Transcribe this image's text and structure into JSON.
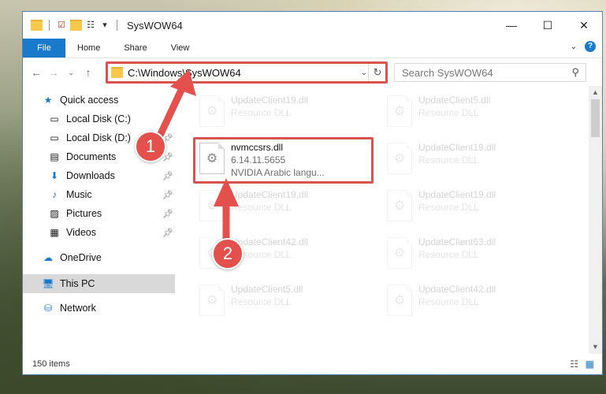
{
  "window": {
    "title": "SysWOW64"
  },
  "window_controls": {
    "minimize": "—",
    "maximize": "☐",
    "close": "✕"
  },
  "ribbon": {
    "file": "File",
    "home": "Home",
    "share": "Share",
    "view": "View",
    "expand": "⌄",
    "help": "?"
  },
  "address": {
    "path": "C:\\Windows\\SysWOW64"
  },
  "search": {
    "placeholder": "Search SysWOW64"
  },
  "sidebar": {
    "quick_access": "Quick access",
    "items": [
      {
        "label": "Local Disk (C:)"
      },
      {
        "label": "Local Disk (D:)"
      },
      {
        "label": "Documents"
      },
      {
        "label": "Downloads"
      },
      {
        "label": "Music"
      },
      {
        "label": "Pictures"
      },
      {
        "label": "Videos"
      }
    ],
    "onedrive": "OneDrive",
    "this_pc": "This PC",
    "network": "Network"
  },
  "files": {
    "selected": {
      "name": "nvmccsrs.dll",
      "version": "6.14.11.5655",
      "description": "NVIDIA Arabic langu..."
    },
    "faded": [
      {
        "name": "UpdateClient19.dll",
        "type": "Resource DLL"
      },
      {
        "name": "UpdateClient5.dll",
        "type": "Resource DLL"
      },
      {
        "name": "UpdateClient19.dll",
        "type": "Resource DLL"
      },
      {
        "name": "UpdateClient19.dll",
        "type": "Resource DLL"
      },
      {
        "name": "UpdateClient19.dll",
        "type": "Resource DLL"
      },
      {
        "name": "UpdateClient42.dll",
        "type": "Resource DLL"
      },
      {
        "name": "UpdateClient63.dll",
        "type": "Resource DLL"
      },
      {
        "name": "UpdateClient5.dll",
        "type": "Resource DLL"
      },
      {
        "name": "UpdateClient42.dll",
        "type": "Resource DLL"
      }
    ]
  },
  "status": {
    "count": "150 items"
  },
  "annotations": {
    "step1": "1",
    "step2": "2"
  },
  "colors": {
    "accent": "#1979ca",
    "highlight": "#d9534f",
    "badge": "#e4514c"
  }
}
